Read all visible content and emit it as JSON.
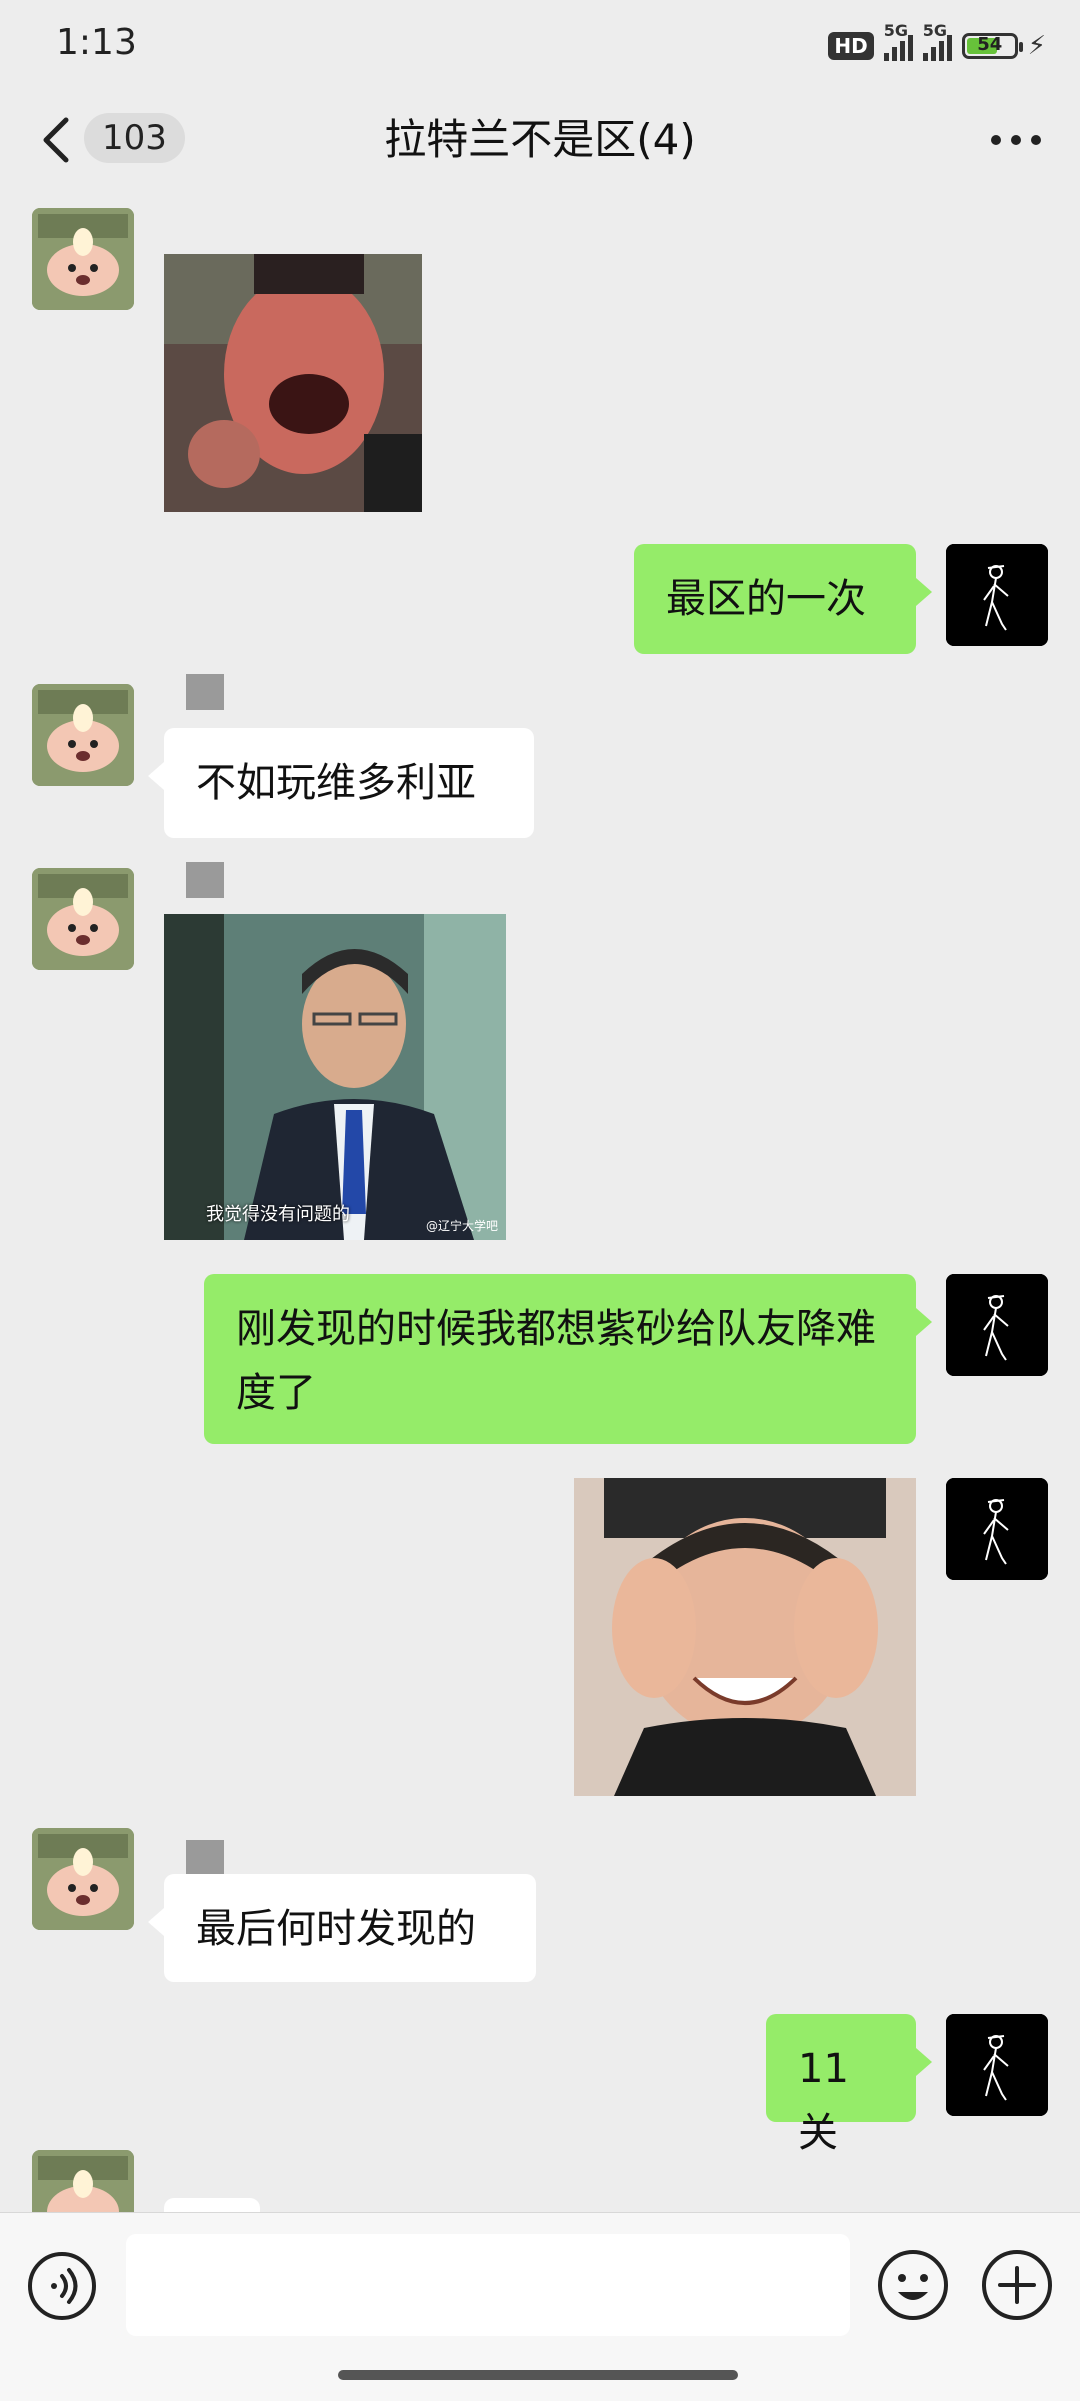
{
  "status_bar": {
    "time": "1:13",
    "hd_label": "HD",
    "network_1": "5G",
    "network_2": "5G",
    "battery": "54"
  },
  "header": {
    "unread_count": "103",
    "title": "拉特兰不是区(4)"
  },
  "messages": [
    {
      "side": "left",
      "type": "image"
    },
    {
      "side": "right",
      "type": "text",
      "text": "最区的一次"
    },
    {
      "side": "left",
      "type": "text",
      "text": "不如玩维多利亚"
    },
    {
      "side": "left",
      "type": "image",
      "caption": "我觉得没有问题的",
      "watermark": "@辽宁大学吧"
    },
    {
      "side": "right",
      "type": "text",
      "text": "刚发现的时候我都想紫砂给队友降难度了"
    },
    {
      "side": "right",
      "type": "image"
    },
    {
      "side": "left",
      "type": "text",
      "text": "最后何时发现的"
    },
    {
      "side": "right",
      "type": "text",
      "text": "11关"
    }
  ],
  "input": {
    "value": "",
    "placeholder": ""
  },
  "icons": {
    "back": "chevron-left-icon",
    "more": "more-dots-icon",
    "voice": "voice-icon",
    "emoji": "emoji-icon",
    "plus": "plus-icon"
  },
  "colors": {
    "background": "#ededed",
    "bubble_right": "#95ec69",
    "bubble_left": "#ffffff",
    "input_bar": "#f7f7f7"
  }
}
